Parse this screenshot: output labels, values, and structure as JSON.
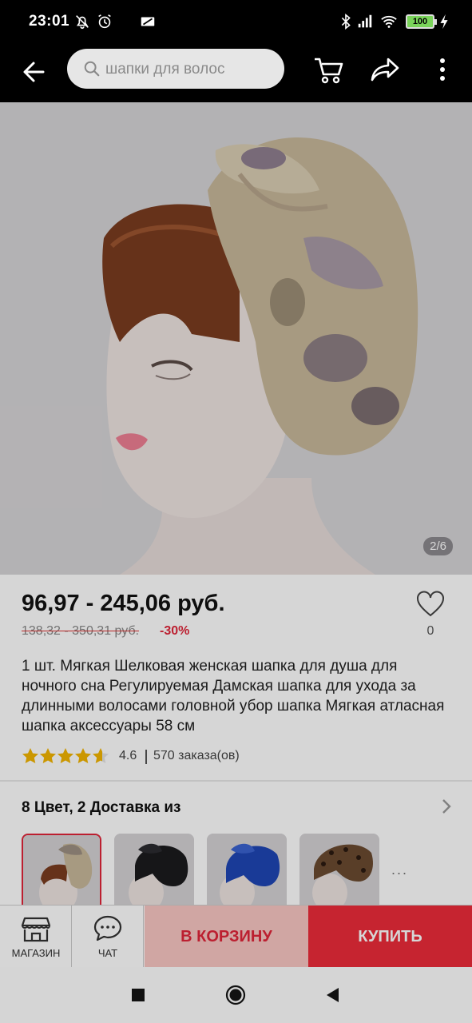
{
  "status_bar": {
    "time": "23:01",
    "battery": "100",
    "icons": [
      "mute-bell-icon",
      "alarm-icon",
      "screen-cast-icon",
      "bluetooth-icon",
      "signal-icon",
      "wifi-icon",
      "battery-icon",
      "charging-icon"
    ]
  },
  "toolbar": {
    "search_placeholder": "шапки для волос",
    "icons": [
      "back-arrow-icon",
      "search-icon",
      "cart-icon",
      "share-icon",
      "more-vert-icon"
    ]
  },
  "gallery": {
    "counter": "2/6"
  },
  "product": {
    "price": "96,97 - 245,06 руб.",
    "old_price": "138,32 - 350,31 руб.",
    "discount": "-30%",
    "favorites_count": "0",
    "title": "1 шт. Мягкая Шелковая женская шапка для душа для ночного сна Регулируемая Дамская шапка для ухода за длинными волосами головной убор шапка Мягкая атласная шапка аксессуары 58 см",
    "rating": 4.6,
    "rating_text": "4.6",
    "orders": "570 заказа(ов)"
  },
  "variants": {
    "title": "8 Цвет, 2 Доставка из",
    "more": "...",
    "items": [
      {
        "color": "#c8b89a",
        "selected": true
      },
      {
        "color": "#1b1b1d",
        "selected": false
      },
      {
        "color": "#1e46b4",
        "selected": false
      },
      {
        "color": "#6b4a30",
        "selected": false
      }
    ]
  },
  "actions": {
    "store_label": "МАГАЗИН",
    "chat_label": "ЧАТ",
    "cart_label": "В КОРЗИНУ",
    "buy_label": "КУПИТЬ"
  },
  "colors": {
    "accent": "#ec2b3a",
    "accent_light": "#f8c6c3",
    "star": "#f2b400"
  }
}
